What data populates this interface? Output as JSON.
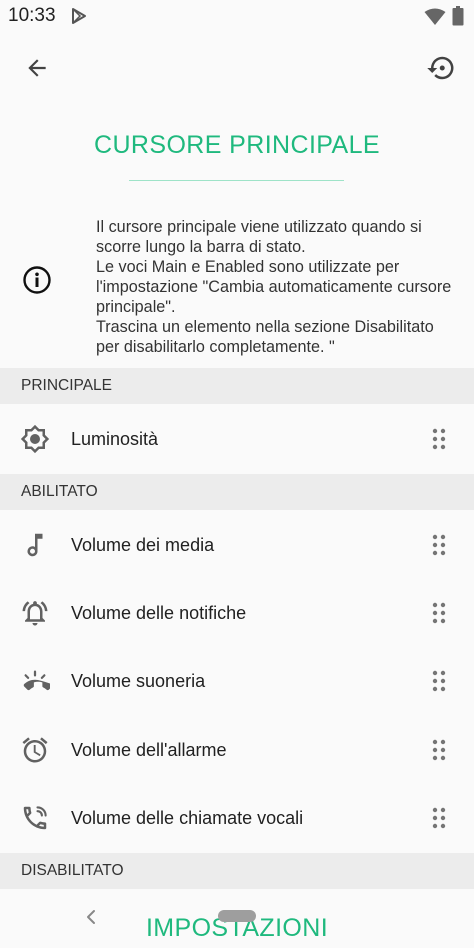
{
  "status_bar": {
    "time": "10:33",
    "icons": [
      "play-store-icon",
      "wifi-icon",
      "battery-icon"
    ]
  },
  "toolbar": {
    "back_icon": "back-arrow-icon",
    "reset_icon": "restore-icon"
  },
  "title": "CURSORE PRINCIPALE",
  "info": {
    "icon": "info-icon",
    "lines": [
      "Il cursore principale viene utilizzato quando si",
      "scorre lungo la barra di stato.",
      "Le voci Main e Enabled sono utilizzate per",
      "l'impostazione \"Cambia automaticamente cursore",
      "principale\".",
      "Trascina un elemento nella sezione Disabilitato",
      "per disabilitarlo completamente. \""
    ]
  },
  "sections": {
    "principale": {
      "header": "PRINCIPALE",
      "items": [
        {
          "label": "Luminosità",
          "icon": "brightness-icon"
        }
      ]
    },
    "abilitato": {
      "header": "ABILITATO",
      "items": [
        {
          "label": "Volume dei media",
          "icon": "music-note-icon"
        },
        {
          "label": "Volume delle notifiche",
          "icon": "notification-bell-icon"
        },
        {
          "label": "Volume suoneria",
          "icon": "ringer-icon"
        },
        {
          "label": "Volume dell'allarme",
          "icon": "alarm-clock-icon"
        },
        {
          "label": "Volume delle chiamate vocali",
          "icon": "phone-call-icon"
        }
      ]
    },
    "disabilitato": {
      "header": "DISABILITATO",
      "items": []
    }
  },
  "bottom_banner": "IMPOSTAZIONI",
  "colors": {
    "accent": "#1fb97e",
    "icon_gray": "#616161",
    "section_bg": "#ececec",
    "background": "#fafafa"
  }
}
